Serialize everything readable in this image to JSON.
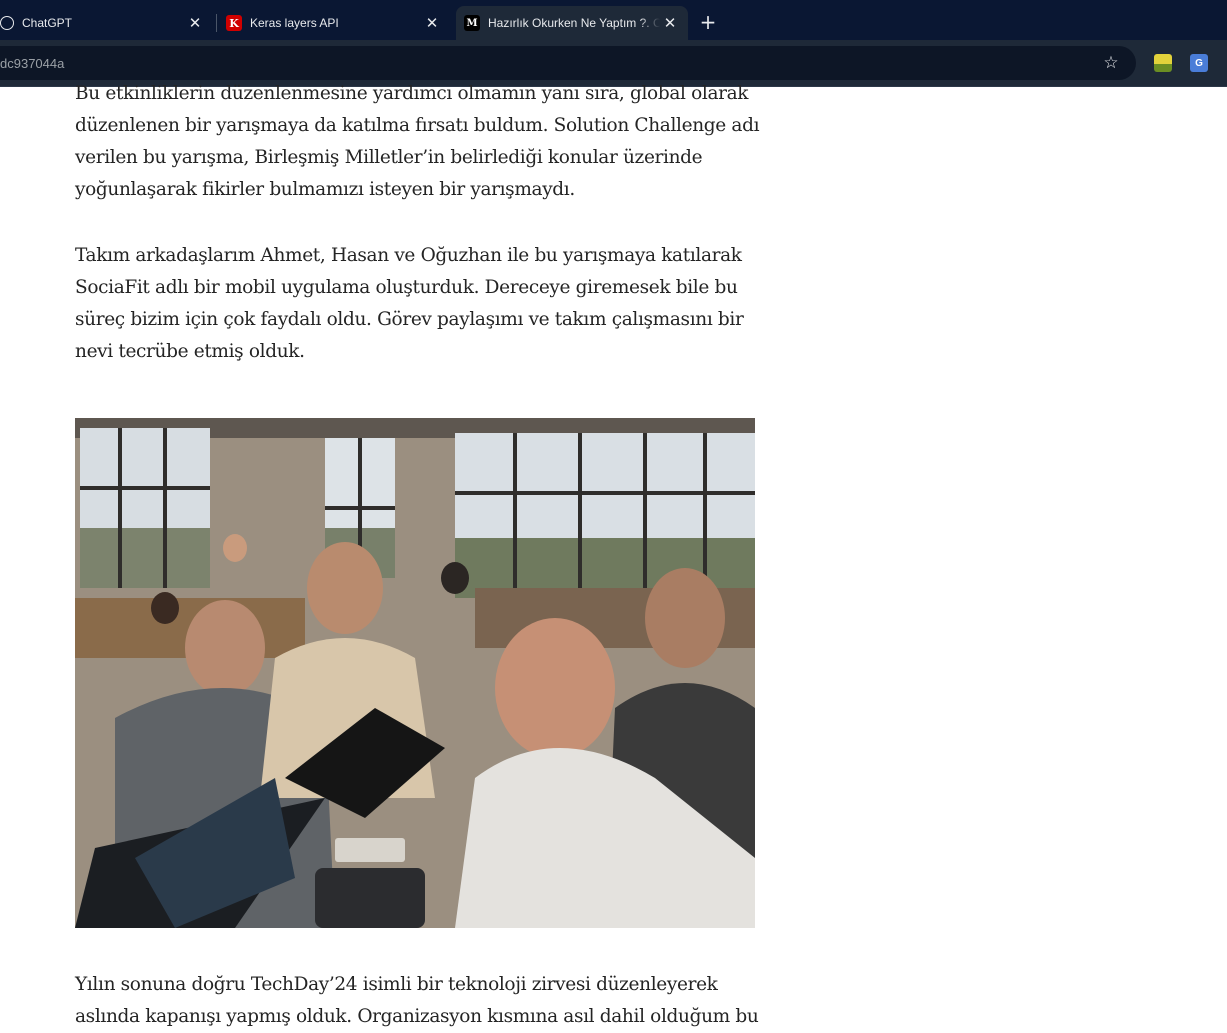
{
  "browser": {
    "tabs": [
      {
        "title": "ChatGPT",
        "favicon": "chatgpt-icon"
      },
      {
        "title": "Keras layers API",
        "favicon": "keras-icon",
        "favicon_letter": "K"
      },
      {
        "title": "Hazırlık Okurken Ne Yaptım ?. C",
        "favicon": "medium-icon",
        "favicon_letter": "M",
        "active": true
      }
    ],
    "new_tab_label": "+",
    "url": "dc937044a",
    "extensions": [
      "extension-icon",
      "google-translate-icon"
    ]
  },
  "article": {
    "paragraph_1": "Bu etkinliklerin düzenlenmesine yardımcı olmamın yanı sıra, global olarak düzenlenen bir yarışmaya da katılma fırsatı buldum. Solution Challenge adı verilen bu yarışma, Birleşmiş Milletler’in belirlediği konular üzerinde yoğunlaşarak fikirler bulmamızı isteyen bir yarışmaydı.",
    "paragraph_2": "Takım arkadaşlarım Ahmet, Hasan ve Oğuzhan ile bu yarışmaya katılarak SociaFit adlı bir mobil uygulama oluşturduk. Dereceye giremesek bile bu süreç bizim için çok faydalı oldu. Görev paylaşımı ve takım çalışmasını bir nevi tecrübe etmiş olduk.",
    "paragraph_3": "Yılın sonuna doğru TechDay’24 isimli bir teknoloji zirvesi düzenleyerek aslında kapanışı yapmış olduk. Organizasyon kısmına asıl dahil olduğum bu"
  },
  "colors": {
    "tabbar": "#0a1733",
    "toolbar": "#1e2938",
    "text": "#242424"
  }
}
